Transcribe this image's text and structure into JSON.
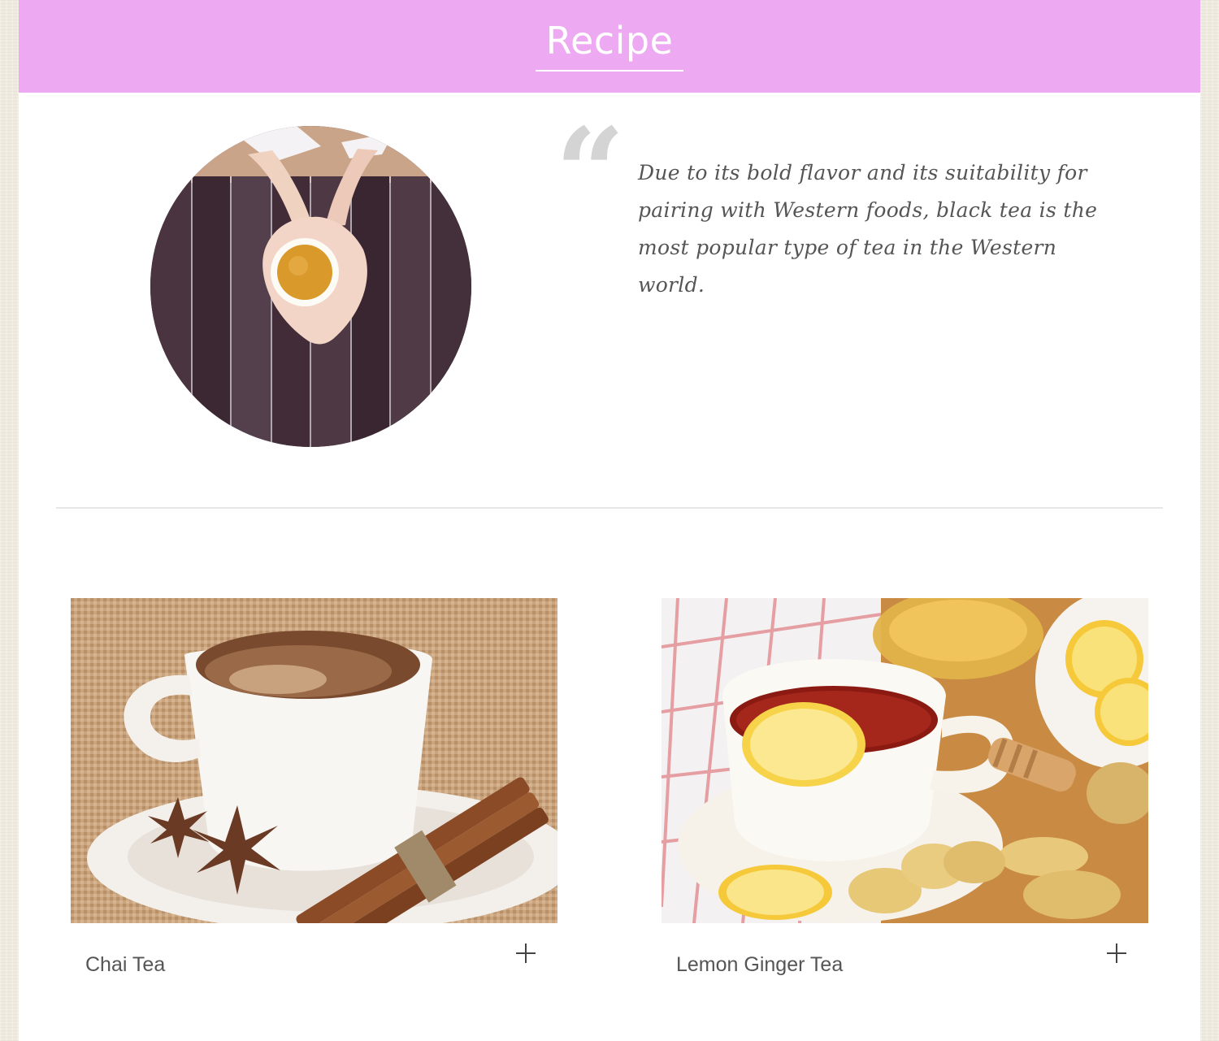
{
  "header": {
    "title": "Recipe"
  },
  "intro": {
    "photo_icon": "tea-cup-in-hands-photo",
    "quote_icon": "quote-open-icon",
    "quote_text": "Due to its bold flavor and its suitability for pairing with Western foods, black tea is the most popular type of tea in the Western world."
  },
  "recipes": [
    {
      "title": "Chai Tea",
      "photo_icon": "chai-tea-photo",
      "expand_icon": "plus-icon"
    },
    {
      "title": "Lemon Ginger Tea",
      "photo_icon": "lemon-ginger-tea-photo",
      "expand_icon": "plus-icon"
    }
  ],
  "colors": {
    "header_bg": "#eda9f2",
    "header_text": "#ffffff",
    "quote_mark": "#d4d4d4",
    "text": "#555555",
    "divider": "#e6e6e6"
  }
}
